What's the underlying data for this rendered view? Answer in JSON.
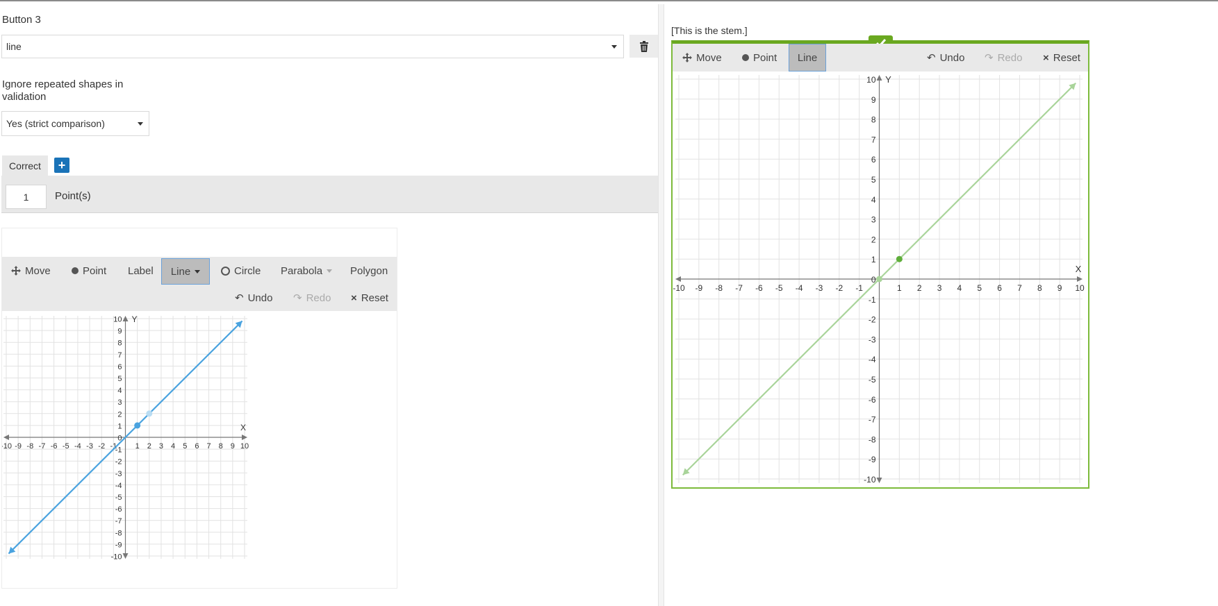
{
  "left": {
    "field_label": "Button 3",
    "shape_select": {
      "value": "line"
    },
    "ignore_label": "Ignore repeated shapes in validation",
    "ignore_select": {
      "value": "Yes (strict comparison)"
    },
    "tabs": [
      {
        "label": "Correct"
      }
    ],
    "add_label": "+",
    "points": {
      "value": "1",
      "label": "Point(s)"
    },
    "toolbar": {
      "move": "Move",
      "point": "Point",
      "label": "Label",
      "line": "Line",
      "circle": "Circle",
      "parabola": "Parabola",
      "polygon": "Polygon",
      "undo": "Undo",
      "redo": "Redo",
      "reset": "Reset"
    },
    "graph": {
      "x_axis_label": "X",
      "y_axis_label": "Y",
      "x_range": [
        -10,
        10
      ],
      "y_range": [
        -10,
        10
      ],
      "grid": true,
      "line": {
        "through": [
          [
            0,
            0
          ],
          [
            1,
            1
          ]
        ],
        "color": "#4aa3df"
      },
      "points": [
        {
          "x": 1,
          "y": 1,
          "color": "#4aa3df"
        },
        {
          "x": 2,
          "y": 2,
          "color": "#b9dcf2"
        }
      ]
    }
  },
  "right": {
    "stem": "[This is the stem.]",
    "toolbar": {
      "move": "Move",
      "point": "Point",
      "line": "Line",
      "undo": "Undo",
      "redo": "Redo",
      "reset": "Reset"
    },
    "graph": {
      "x_axis_label": "X",
      "y_axis_label": "Y",
      "x_range": [
        -10,
        10
      ],
      "y_range": [
        -10,
        10
      ],
      "grid": true,
      "line": {
        "through": [
          [
            0,
            0
          ],
          [
            1,
            1
          ]
        ],
        "color": "#a9d49a"
      },
      "points": [
        {
          "x": 1,
          "y": 1,
          "color": "#5fae3a"
        },
        {
          "x": 0,
          "y": 0,
          "color": "#a9d49a"
        }
      ]
    },
    "status_color": "#6aa820"
  }
}
